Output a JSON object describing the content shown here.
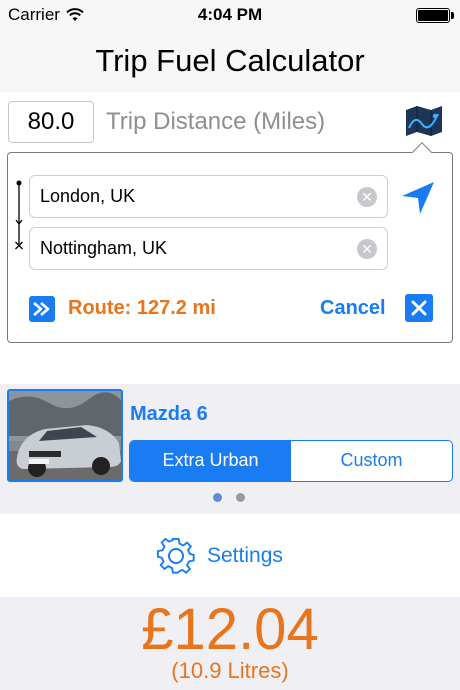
{
  "status": {
    "carrier": "Carrier",
    "time": "4:04 PM"
  },
  "header": {
    "title": "Trip Fuel Calculator"
  },
  "trip": {
    "distance": "80.0",
    "distance_label": "Trip Distance (Miles)"
  },
  "route": {
    "from": "London, UK",
    "to": "Nottingham, UK",
    "summary": "Route: 127.2 mi",
    "cancel_label": "Cancel"
  },
  "car": {
    "name": "Mazda 6",
    "modes": [
      "Extra Urban",
      "Custom"
    ],
    "selected_mode": "Extra Urban",
    "page_count": 2,
    "current_page": 1
  },
  "settings": {
    "label": "Settings"
  },
  "result": {
    "price": "£12.04",
    "litres": "(10.9 Litres)"
  },
  "colors": {
    "accent": "#1a7cf2",
    "highlight": "#e8741c"
  },
  "icons": [
    "wifi-icon",
    "battery-icon",
    "map-icon",
    "location-arrow-icon",
    "fast-forward-icon",
    "close-icon",
    "gear-icon",
    "clear-icon"
  ]
}
